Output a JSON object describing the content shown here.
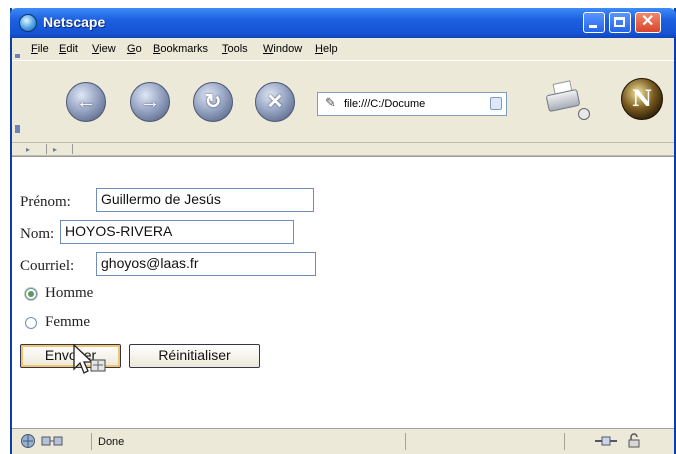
{
  "window": {
    "title": "Netscape"
  },
  "menubar": {
    "items": [
      {
        "mn": "F",
        "rest": "ile"
      },
      {
        "mn": "E",
        "rest": "dit"
      },
      {
        "mn": "V",
        "rest": "iew"
      },
      {
        "mn": "G",
        "rest": "o"
      },
      {
        "mn": "B",
        "rest": "ookmarks"
      },
      {
        "mn": "T",
        "rest": "ools"
      },
      {
        "mn": "W",
        "rest": "indow"
      },
      {
        "mn": "H",
        "rest": "elp"
      }
    ]
  },
  "toolbar": {
    "back_icon": "back-arrow-icon",
    "forward_icon": "forward-arrow-icon",
    "reload_icon": "reload-icon",
    "stop_icon": "stop-icon",
    "url": "file:///C:/Docume",
    "print_icon": "print-icon",
    "logo_letter": "N"
  },
  "form": {
    "prenom_label": "Prénom:",
    "prenom_value": "Guillermo de Jesús",
    "nom_label": "Nom:",
    "nom_value": "HOYOS-RIVERA",
    "courriel_label": "Courriel:",
    "courriel_value": "ghoyos@laas.fr",
    "gender_options": [
      {
        "label": "Homme",
        "selected": true
      },
      {
        "label": "Femme",
        "selected": false
      }
    ],
    "submit_label": "Envoyer",
    "reset_label": "Réinitialiser"
  },
  "statusbar": {
    "status_text": "Done"
  },
  "colors": {
    "titlebar": "#1c5fe0",
    "chrome": "#ece9d8",
    "field_border": "#6f8fb5"
  }
}
